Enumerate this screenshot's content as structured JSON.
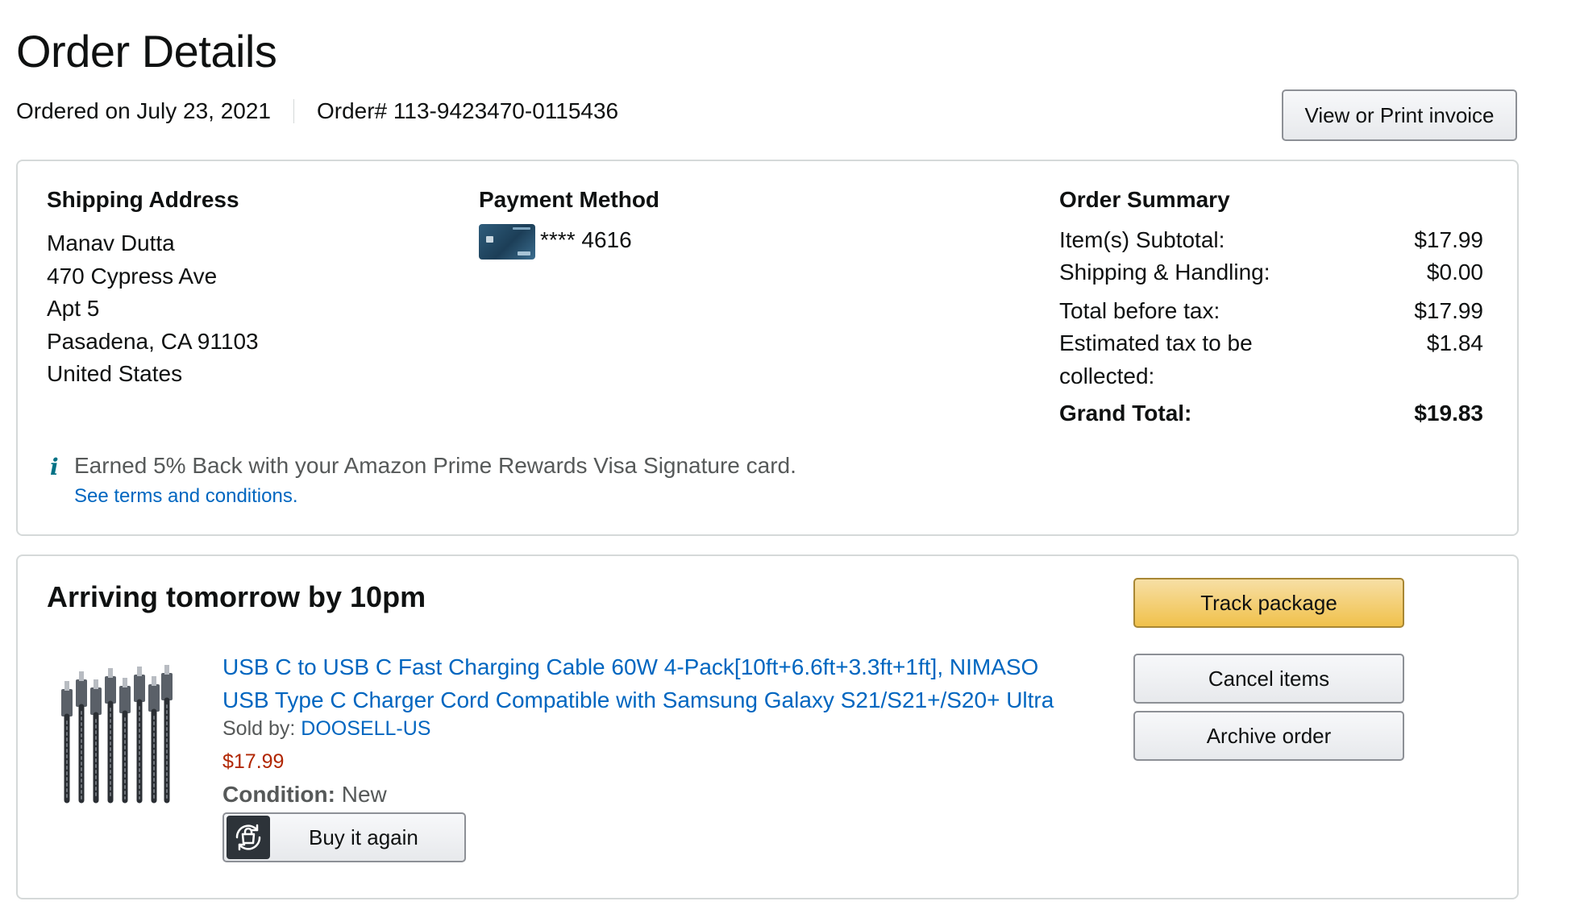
{
  "header": {
    "title": "Order Details",
    "ordered_on": "Ordered on July 23, 2021",
    "order_number": "Order# 113-9423470-0115436",
    "invoice_button": "View or Print invoice"
  },
  "shipping": {
    "title": "Shipping Address",
    "lines": [
      "Manav Dutta",
      "470 Cypress Ave",
      "Apt 5",
      "Pasadena, CA 91103",
      "United States"
    ]
  },
  "payment": {
    "title": "Payment Method",
    "card_icon": "credit-card-icon",
    "card_number": "**** 4616"
  },
  "summary": {
    "title": "Order Summary",
    "rows": [
      {
        "label": "Item(s) Subtotal:",
        "value": "$17.99"
      },
      {
        "label": "Shipping & Handling:",
        "value": "$0.00"
      },
      {
        "label": "Total before tax:",
        "value": "$17.99"
      },
      {
        "label": "Estimated tax to be collected:",
        "value": "$1.84"
      },
      {
        "label": "Grand Total:",
        "value": "$19.83"
      }
    ]
  },
  "rewards": {
    "icon": "info-icon",
    "icon_glyph": "i",
    "text": "Earned 5% Back with your Amazon Prime Rewards Visa Signature card.",
    "link": "See terms and conditions."
  },
  "shipment": {
    "status": "Arriving tomorrow by 10pm",
    "buttons": {
      "track": "Track package",
      "cancel": "Cancel items",
      "archive": "Archive order"
    },
    "item": {
      "title": "USB C to USB C Fast Charging Cable 60W 4-Pack[10ft+6.6ft+3.3ft+1ft], NIMASO USB Type C Charger Cord Compatible with Samsung Galaxy S21/S21+/S20+ Ultra",
      "sold_by_label": "Sold by:",
      "seller": "DOOSELL-US",
      "price": "$17.99",
      "condition_label": "Condition:",
      "condition_value": "New",
      "buy_again": "Buy it again",
      "buy_again_icon": "reorder-icon"
    }
  },
  "colors": {
    "link": "#0066c0",
    "price": "#b12704",
    "track_button": "#f0c14b",
    "border": "#d5d9d9"
  }
}
